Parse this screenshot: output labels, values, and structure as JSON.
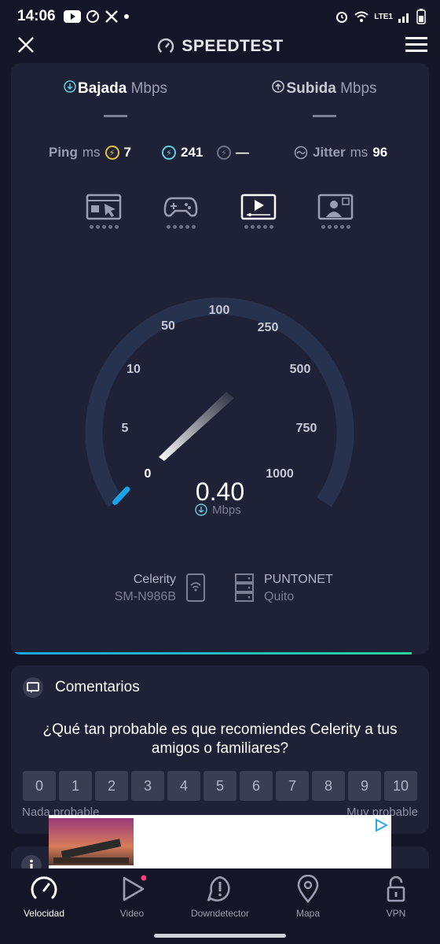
{
  "status_bar": {
    "time": "14:06",
    "network_label": "LTE1"
  },
  "header": {
    "title": "SPEEDTEST"
  },
  "tabs": [
    {
      "label": "Bajada",
      "unit": "Mbps"
    },
    {
      "label": "Subida",
      "unit": "Mbps"
    }
  ],
  "ping": {
    "label": "Ping",
    "unit": "ms",
    "idle_value": "7",
    "down_value": "241",
    "up_value": "—"
  },
  "jitter": {
    "label": "Jitter",
    "unit": "ms",
    "value": "96"
  },
  "activities": [
    "browser-icon",
    "game-controller-icon",
    "video-icon",
    "video-call-icon"
  ],
  "gauge": {
    "ticks": [
      "0",
      "5",
      "10",
      "50",
      "100",
      "250",
      "500",
      "750",
      "1000"
    ],
    "speed": "0.40",
    "unit": "Mbps"
  },
  "provider": {
    "name": "Celerity",
    "device": "SM-N986B"
  },
  "server": {
    "name": "PUNTONET",
    "city": "Quito"
  },
  "feedback": {
    "title": "Comentarios",
    "question": "¿Qué tan probable es que recomiendes Celerity a tus amigos o familiares?",
    "scale": [
      "0",
      "1",
      "2",
      "3",
      "4",
      "5",
      "6",
      "7",
      "8",
      "9",
      "10"
    ],
    "low_label": "Nada probable",
    "high_label": "Muy probable"
  },
  "nav": [
    {
      "label": "Velocidad",
      "icon": "speedometer-icon"
    },
    {
      "label": "Video",
      "icon": "play-icon"
    },
    {
      "label": "Downdetector",
      "icon": "alert-icon"
    },
    {
      "label": "Mapa",
      "icon": "map-pin-icon"
    },
    {
      "label": "VPN",
      "icon": "unlock-icon"
    }
  ],
  "colors": {
    "accent_blue": "#1aa3e8",
    "accent_green": "#2cd39a",
    "badge_yellow": "#e5c13b",
    "notification_pink": "#ff3d7f"
  }
}
